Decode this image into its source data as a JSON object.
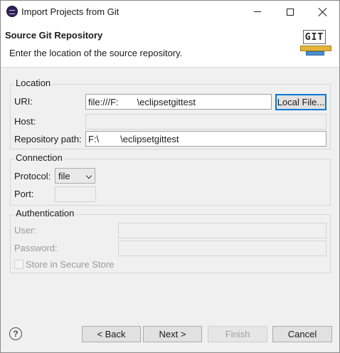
{
  "window": {
    "title": "Import Projects from Git"
  },
  "banner": {
    "title": "Source Git Repository",
    "description": "Enter the location of the source repository.",
    "logo_text": "GIT"
  },
  "location": {
    "group_label": "Location",
    "uri_label": "URI:",
    "uri_prefix": "file:///F:",
    "uri_suffix": "\\eclipsetgittest",
    "local_file_button": "Local File...",
    "host_label": "Host:",
    "host_value": "",
    "repo_path_label": "Repository path:",
    "repo_path_prefix": "F:\\",
    "repo_path_suffix": "\\eclipsetgittest"
  },
  "connection": {
    "group_label": "Connection",
    "protocol_label": "Protocol:",
    "protocol_value": "file",
    "port_label": "Port:",
    "port_value": ""
  },
  "authentication": {
    "group_label": "Authentication",
    "user_label": "User:",
    "password_label": "Password:",
    "store_label": "Store in Secure Store"
  },
  "footer": {
    "help_glyph": "?",
    "back_label": "< Back",
    "next_label": "Next >",
    "finish_label": "Finish",
    "cancel_label": "Cancel"
  },
  "colors": {
    "default_button_border": "#0078d7",
    "dialog_bg": "#f0f0f0"
  }
}
